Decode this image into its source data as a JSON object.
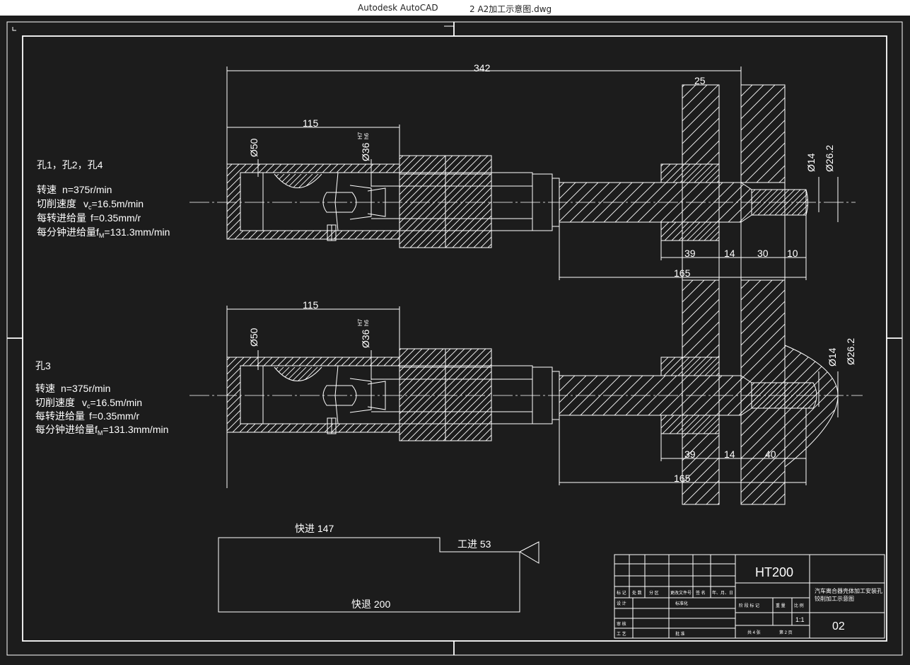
{
  "window": {
    "app_name": "Autodesk AutoCAD",
    "file_name": "2 A2加工示意图.dwg"
  },
  "drawing": {
    "dims": {
      "overall": "342",
      "plate": "25",
      "len_top": "115",
      "len_bottom": "115",
      "dia50": "Ø50",
      "dia36": "Ø36",
      "fit_top": "H7",
      "fit_bot": "h6",
      "dia14": "Ø14",
      "dia26": "Ø26.2",
      "d39": "39",
      "d14": "14",
      "d30": "30",
      "d10": "10",
      "d165": "165",
      "d40": "40"
    },
    "notes_top": {
      "holes": "孔1，孔2，孔4",
      "speed_label": "转速",
      "speed": "n=375r/min",
      "cut_label": "切削速度",
      "cut_v": "v",
      "cut_sub": "c",
      "cut_val": "=16.5m/min",
      "feed_label": "每转进给量",
      "feed": "f=0.35mm/r",
      "fm_label": "每分钟进给量f",
      "fm_sub": "M",
      "fm_val": "=131.3mm/min"
    },
    "notes_bottom": {
      "holes": "孔3",
      "speed_label": "转速",
      "speed": "n=375r/min",
      "cut_label": "切削速度",
      "cut_v": "v",
      "cut_sub": "c",
      "cut_val": "=16.5m/min",
      "feed_label": "每转进给量",
      "feed": "f=0.35mm/r",
      "fm_label": "每分钟进给量f",
      "fm_sub": "M",
      "fm_val": "=131.3mm/min"
    },
    "cycle": {
      "rapid_in": "快进 147",
      "work_in": "工进 53",
      "rapid_out": "快退 200"
    },
    "title_block": {
      "material": "HT200",
      "title_line1": "汽车离合器壳体加工安装孔",
      "title_line2": "铰削加工示意图",
      "scale": "1:1",
      "drawing_no": "02",
      "row_labels": [
        "标 记",
        "处 数",
        "分 区",
        "更改文件号",
        "签 名",
        "年、月、日"
      ],
      "design": "设 计",
      "standard": "标准化",
      "check": "审 核",
      "process": "工 艺",
      "approve": "批 准",
      "stage_labels": [
        "阶 段 标 记",
        "重 量",
        "比 例"
      ],
      "sheets": "共 4 张",
      "sheet": "第 2 页"
    }
  },
  "colors": {
    "background": "#1c1c1c",
    "line": "#ffffff",
    "titlebar": "#ffffff"
  }
}
